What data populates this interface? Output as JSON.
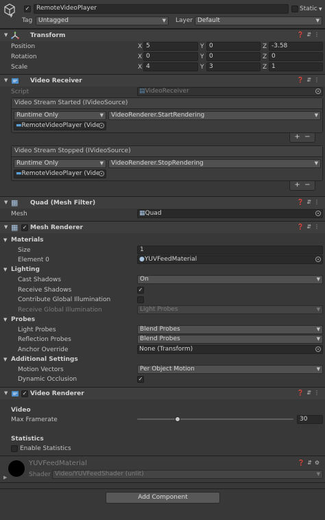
{
  "gameobject": {
    "name": "RemoteVideoPlayer",
    "active": true,
    "static_label": "Static",
    "tag_label": "Tag",
    "tag_value": "Untagged",
    "layer_label": "Layer",
    "layer_value": "Default"
  },
  "transform": {
    "title": "Transform",
    "position_label": "Position",
    "rotation_label": "Rotation",
    "scale_label": "Scale",
    "axis_x": "X",
    "axis_y": "Y",
    "axis_z": "Z",
    "position": {
      "x": "5",
      "y": "0",
      "z": "-3.58"
    },
    "rotation": {
      "x": "0",
      "y": "0",
      "z": "0"
    },
    "scale": {
      "x": "4",
      "y": "3",
      "z": "1"
    }
  },
  "video_receiver": {
    "title": "Video Receiver",
    "script_label": "Script",
    "script_value": "VideoReceiver",
    "started_event": {
      "title": "Video Stream Started (IVideoSource)",
      "mode": "Runtime Only",
      "function": "VideoRenderer.StartRendering",
      "target": "RemoteVideoPlayer (Vide"
    },
    "stopped_event": {
      "title": "Video Stream Stopped (IVideoSource)",
      "mode": "Runtime Only",
      "function": "VideoRenderer.StopRendering",
      "target": "RemoteVideoPlayer (Vide"
    },
    "plus": "+",
    "minus": "−"
  },
  "mesh_filter": {
    "title": "Quad (Mesh Filter)",
    "mesh_label": "Mesh",
    "mesh_value": "Quad"
  },
  "mesh_renderer": {
    "title": "Mesh Renderer",
    "enabled": true,
    "materials_label": "Materials",
    "size_label": "Size",
    "size_value": "1",
    "element0_label": "Element 0",
    "element0_value": "YUVFeedMaterial",
    "lighting_label": "Lighting",
    "cast_shadows_label": "Cast Shadows",
    "cast_shadows_value": "On",
    "receive_shadows_label": "Receive Shadows",
    "receive_shadows": true,
    "contribute_gi_label": "Contribute Global Illumination",
    "contribute_gi": false,
    "receive_gi_label": "Receive Global Illumination",
    "receive_gi_value": "Light Probes",
    "probes_label": "Probes",
    "light_probes_label": "Light Probes",
    "light_probes_value": "Blend Probes",
    "reflection_probes_label": "Reflection Probes",
    "reflection_probes_value": "Blend Probes",
    "anchor_override_label": "Anchor Override",
    "anchor_override_value": "None (Transform)",
    "additional_label": "Additional Settings",
    "motion_vectors_label": "Motion Vectors",
    "motion_vectors_value": "Per Object Motion",
    "dynamic_occlusion_label": "Dynamic Occlusion",
    "dynamic_occlusion": true
  },
  "video_renderer": {
    "title": "Video Renderer",
    "enabled": true,
    "video_label": "Video",
    "max_framerate_label": "Max Framerate",
    "max_framerate_value": "30",
    "slider_fraction": 0.26,
    "statistics_label": "Statistics",
    "enable_statistics_label": "Enable Statistics",
    "enable_statistics": false
  },
  "material": {
    "name": "YUVFeedMaterial",
    "shader_label": "Shader",
    "shader_value": "Video/YUVFeedShader (unlit)"
  },
  "add_component_label": "Add Component",
  "colors": {
    "background": "#383838",
    "field": "#2a2a2a",
    "header": "#3e3e3e",
    "script_icon": "#5aa0d8"
  }
}
